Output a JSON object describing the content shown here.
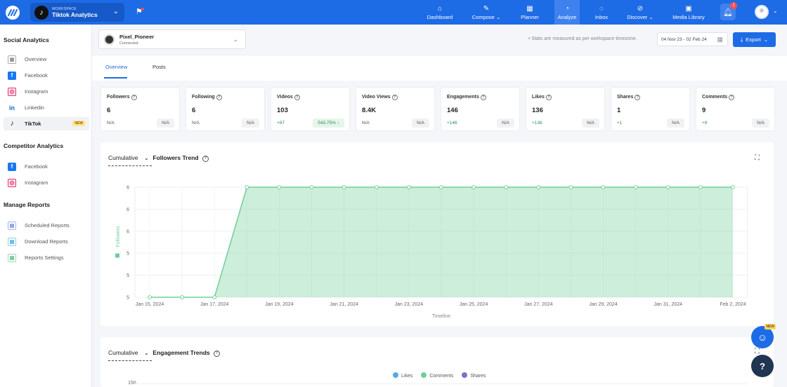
{
  "topbar": {
    "workspace_label": "WORKSPACE",
    "workspace_name": "Tiktok Analytics",
    "nav": [
      {
        "label": "Dashboard",
        "icon": "home-icon"
      },
      {
        "label": "Compose",
        "icon": "pen-icon"
      },
      {
        "label": "Planner",
        "icon": "calendar-icon"
      },
      {
        "label": "Analyze",
        "icon": "chart-icon"
      },
      {
        "label": "Inbox",
        "icon": "chat-icon"
      },
      {
        "label": "Discover",
        "icon": "compass-icon"
      },
      {
        "label": "Media Library",
        "icon": "image-icon"
      }
    ],
    "notification_count": "1"
  },
  "sidebar": {
    "social_title": "Social Analytics",
    "social_items": [
      {
        "label": "Overview"
      },
      {
        "label": "Facebook"
      },
      {
        "label": "Instagram"
      },
      {
        "label": "Linkedin"
      },
      {
        "label": "TikTok",
        "badge": "NEW"
      }
    ],
    "competitor_title": "Competitor Analytics",
    "competitor_items": [
      {
        "label": "Facebook"
      },
      {
        "label": "Instagram"
      }
    ],
    "reports_title": "Manage Reports",
    "reports_items": [
      {
        "label": "Scheduled Reports"
      },
      {
        "label": "Download Reports"
      },
      {
        "label": "Reports Settings"
      }
    ]
  },
  "header": {
    "account_name": "Pixel_Pioneer",
    "account_status": "Connected",
    "timezone_note": "Stats are measured as per workspace timezone.",
    "date_range": "04 Nov 23 - 02 Feb 24",
    "export_label": "Export"
  },
  "tabs": [
    {
      "label": "Overview"
    },
    {
      "label": "Posts"
    }
  ],
  "cards": [
    {
      "title": "Followers",
      "value": "6",
      "delta": "N/A",
      "pct": "N/A"
    },
    {
      "title": "Following",
      "value": "6",
      "delta": "N/A",
      "pct": "N/A"
    },
    {
      "title": "Videos",
      "value": "103",
      "delta": "+87",
      "pct": "543.75% ↑"
    },
    {
      "title": "Video Views",
      "value": "8.4K",
      "delta": "N/A",
      "pct": "N/A"
    },
    {
      "title": "Engagements",
      "value": "146",
      "delta": "+146",
      "pct": "N/A"
    },
    {
      "title": "Likes",
      "value": "136",
      "delta": "+136",
      "pct": "N/A"
    },
    {
      "title": "Shares",
      "value": "1",
      "delta": "+1",
      "pct": "N/A"
    },
    {
      "title": "Comments",
      "value": "9",
      "delta": "+9",
      "pct": "N/A"
    }
  ],
  "followers_panel": {
    "cumulative_label": "Cumulative",
    "title": "Followers Trend"
  },
  "engagement_panel": {
    "cumulative_label": "Cumulative",
    "title": "Engagement Trends",
    "legend": [
      "Likes",
      "Comments",
      "Shares"
    ],
    "legend_colors": [
      "#5aa9e6",
      "#6fcf97",
      "#7b6fc9"
    ],
    "first_tick": "150"
  },
  "chart_data": {
    "type": "area",
    "title": "Followers Trend",
    "xlabel": "Timeline",
    "ylabel": "Followers",
    "color": "#6fcf97",
    "x_tick_labels": [
      "Jan 15, 2024",
      "Jan 17, 2024",
      "Jan 19, 2024",
      "Jan 21, 2024",
      "Jan 23, 2024",
      "Jan 25, 2024",
      "Jan 27, 2024",
      "Jan 29, 2024",
      "Jan 31, 2024",
      "Feb 2, 2024"
    ],
    "y_tick_labels": [
      "5",
      "5",
      "5",
      "6",
      "6",
      "6"
    ],
    "x": [
      "2024-01-15",
      "2024-01-16",
      "2024-01-17",
      "2024-01-18",
      "2024-01-19",
      "2024-01-20",
      "2024-01-21",
      "2024-01-22",
      "2024-01-23",
      "2024-01-24",
      "2024-01-25",
      "2024-01-26",
      "2024-01-27",
      "2024-01-28",
      "2024-01-29",
      "2024-01-30",
      "2024-01-31",
      "2024-02-01",
      "2024-02-02"
    ],
    "values": [
      5,
      5,
      5,
      6,
      6,
      6,
      6,
      6,
      6,
      6,
      6,
      6,
      6,
      6,
      6,
      6,
      6,
      6,
      6
    ],
    "ylim": [
      5,
      6
    ],
    "grid": true
  }
}
